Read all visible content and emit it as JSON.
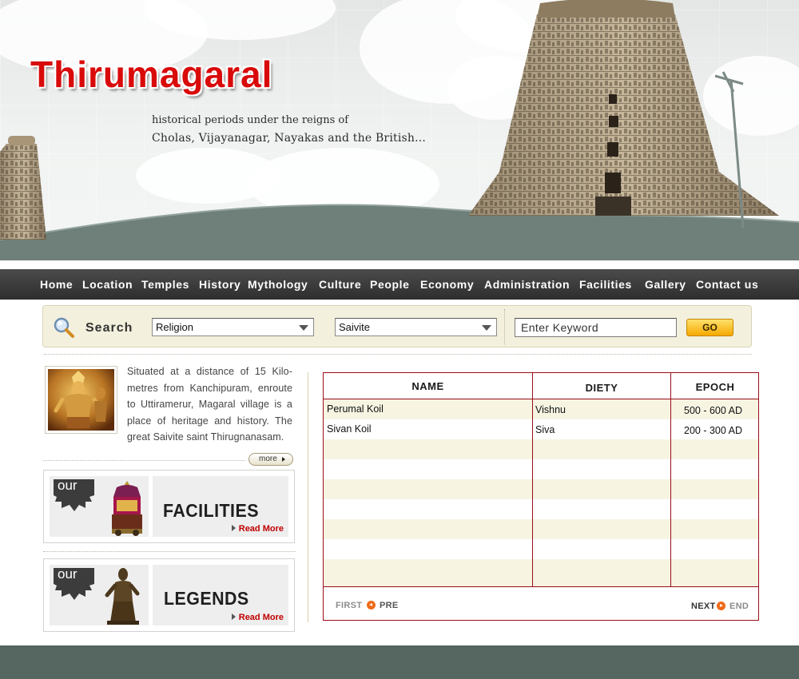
{
  "header": {
    "logo_text": "Thirumagaral",
    "tagline_line1": "historical periods under the reigns of",
    "tagline_line2": "Cholas, Vijayanagar, Nayakas and the British..."
  },
  "nav": {
    "items": [
      "Home",
      "Location",
      "Temples",
      "History",
      "Mythology",
      "Culture",
      "People",
      "Economy",
      "Administration",
      "Facilities",
      "Gallery",
      "Contact us"
    ]
  },
  "search": {
    "label": "Search",
    "category_select": "Religion",
    "subcategory_select": "Saivite",
    "keyword_placeholder": "Enter Keyword",
    "go_label": "GO"
  },
  "intro": {
    "text": "Situated at a distance of 15 Kilo- metres from Kanchipuram, enroute to Uttiramerur, Magaral village is a place of heritage and history. The great Saivite saint Thirugnanasam.",
    "more_label": "more"
  },
  "promos": [
    {
      "badge": "our",
      "title": "FACILITIES",
      "link": "Read More"
    },
    {
      "badge": "our",
      "title": "LEGENDS",
      "link": "Read More"
    }
  ],
  "table": {
    "headers": [
      "NAME",
      "DIETY",
      "EPOCH"
    ],
    "rows": [
      [
        "Perumal Koil",
        "Vishnu",
        "500 - 600 AD"
      ],
      [
        "Sivan Koil",
        "Siva",
        "200 - 300 AD"
      ]
    ],
    "pager": {
      "first": "FIRST",
      "prev": "PRE",
      "next": "NEXT",
      "end": "END"
    }
  },
  "colors": {
    "nav_bg": "#3a3a3a",
    "table_border": "#9a0d19",
    "row_alt": "#f7f4e2",
    "logo_red": "#d90a0a",
    "pager_orange": "#ef6a1a",
    "footer_bg": "#566661"
  },
  "icons": [
    "search-icon",
    "dropdown-arrow-icon",
    "triangle-arrow-icon",
    "orange-circle-arrow-icon"
  ]
}
